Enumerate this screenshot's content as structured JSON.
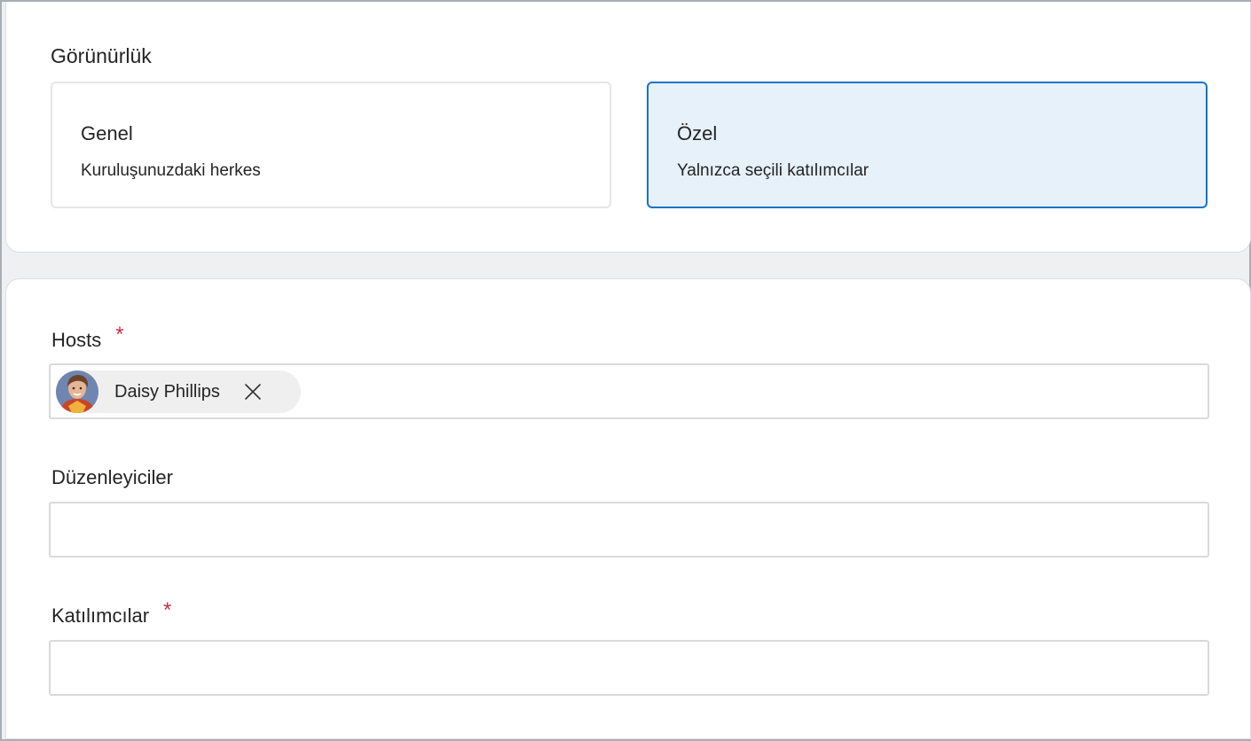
{
  "visibility": {
    "title": "Görünürlük",
    "options": [
      {
        "title": "Genel",
        "description": "Kuruluşunuzdaki herkes",
        "selected": false
      },
      {
        "title": "Özel",
        "description": "Yalnızca seçili katılımcılar",
        "selected": true
      }
    ]
  },
  "people": {
    "hosts": {
      "label": "Hosts",
      "required_mark": "*",
      "chips": [
        {
          "name": "Daisy Phillips",
          "avatar_icon": "person-avatar"
        }
      ]
    },
    "organizers": {
      "label": "Düzenleyiciler",
      "value": ""
    },
    "participants": {
      "label": "Katılımcılar",
      "required_mark": "*",
      "value": ""
    }
  },
  "colors": {
    "accent": "#1a73c5",
    "selected_bg": "#e6f1f9",
    "required": "#c4314b"
  }
}
